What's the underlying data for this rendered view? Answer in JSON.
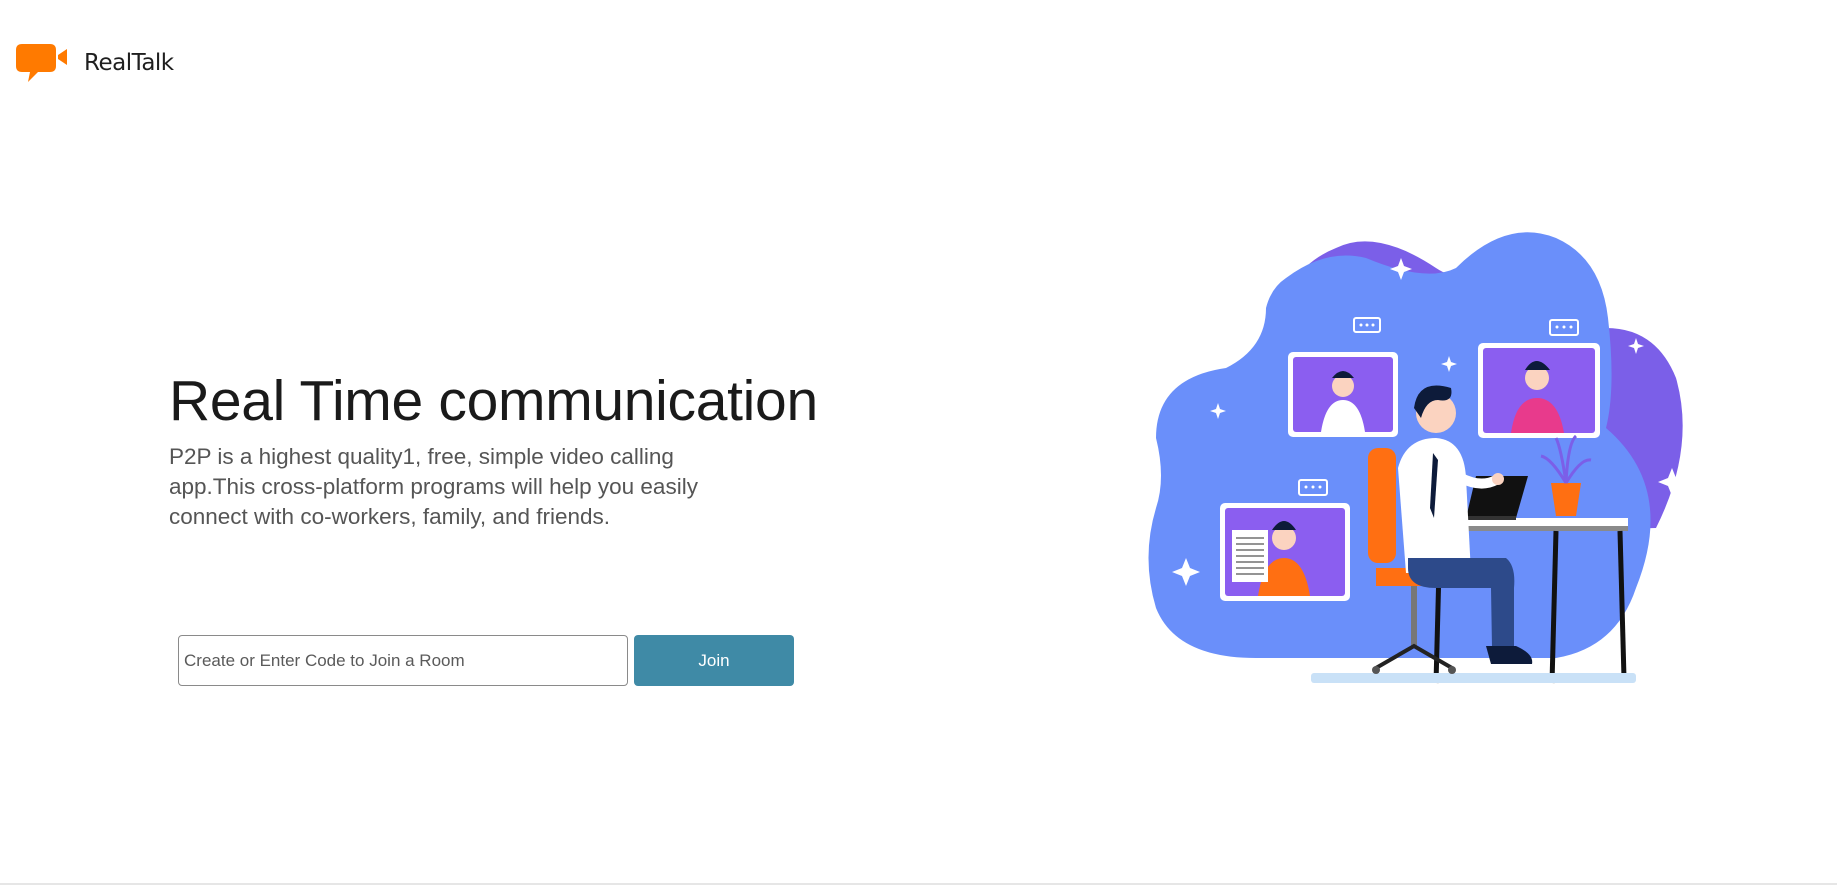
{
  "header": {
    "brand_name": "RealTalk",
    "logo_icon": "video-chat-bubble-icon"
  },
  "hero": {
    "title": "Real Time communication",
    "description": "P2P is a highest quality1, free, simple video calling app.This cross-platform programs will help you easily connect with co-workers, family, and friends."
  },
  "join_form": {
    "input_value": "",
    "input_placeholder": "Create or Enter Code to Join a Room",
    "join_label": "Join"
  },
  "colors": {
    "brand_orange": "#ff7a00",
    "join_button": "#3f8aa6",
    "blob_blue": "#6a8ffa",
    "blob_purple": "#7b5fe8"
  },
  "illustration": {
    "icon": "video-conference-illustration"
  }
}
